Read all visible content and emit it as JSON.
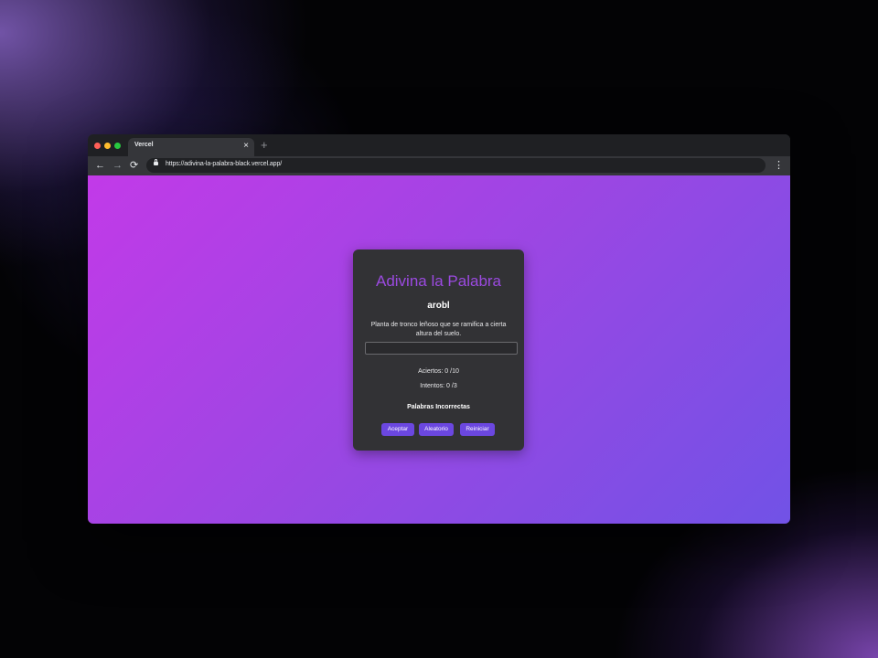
{
  "browser": {
    "tab_title": "Vercel",
    "tab_close": "×",
    "new_tab": "+",
    "url": "https://adivina-la-palabra-black.vercel.app/",
    "nav_back": "←",
    "nav_forward": "→",
    "nav_reload": "⟳",
    "menu": "⋮"
  },
  "game": {
    "title": "Adivina la Palabra",
    "scrambled_word": "arobl",
    "hint": "Planta de tronco leñoso que se ramifica a cierta altura del suelo.",
    "input_value": "",
    "hits_text": "Aciertos: 0 /10",
    "tries_text": "Intentos: 0 /3",
    "wrong_words_title": "Palabras Incorrectas",
    "buttons": {
      "accept": "Aceptar",
      "random": "Aleatorio",
      "reset": "Reiniciar"
    }
  },
  "colors": {
    "title_accent": "#9b4ae0",
    "button": "#6b47e0",
    "gradient_start": "#c23ae8",
    "gradient_end": "#7152e6"
  }
}
